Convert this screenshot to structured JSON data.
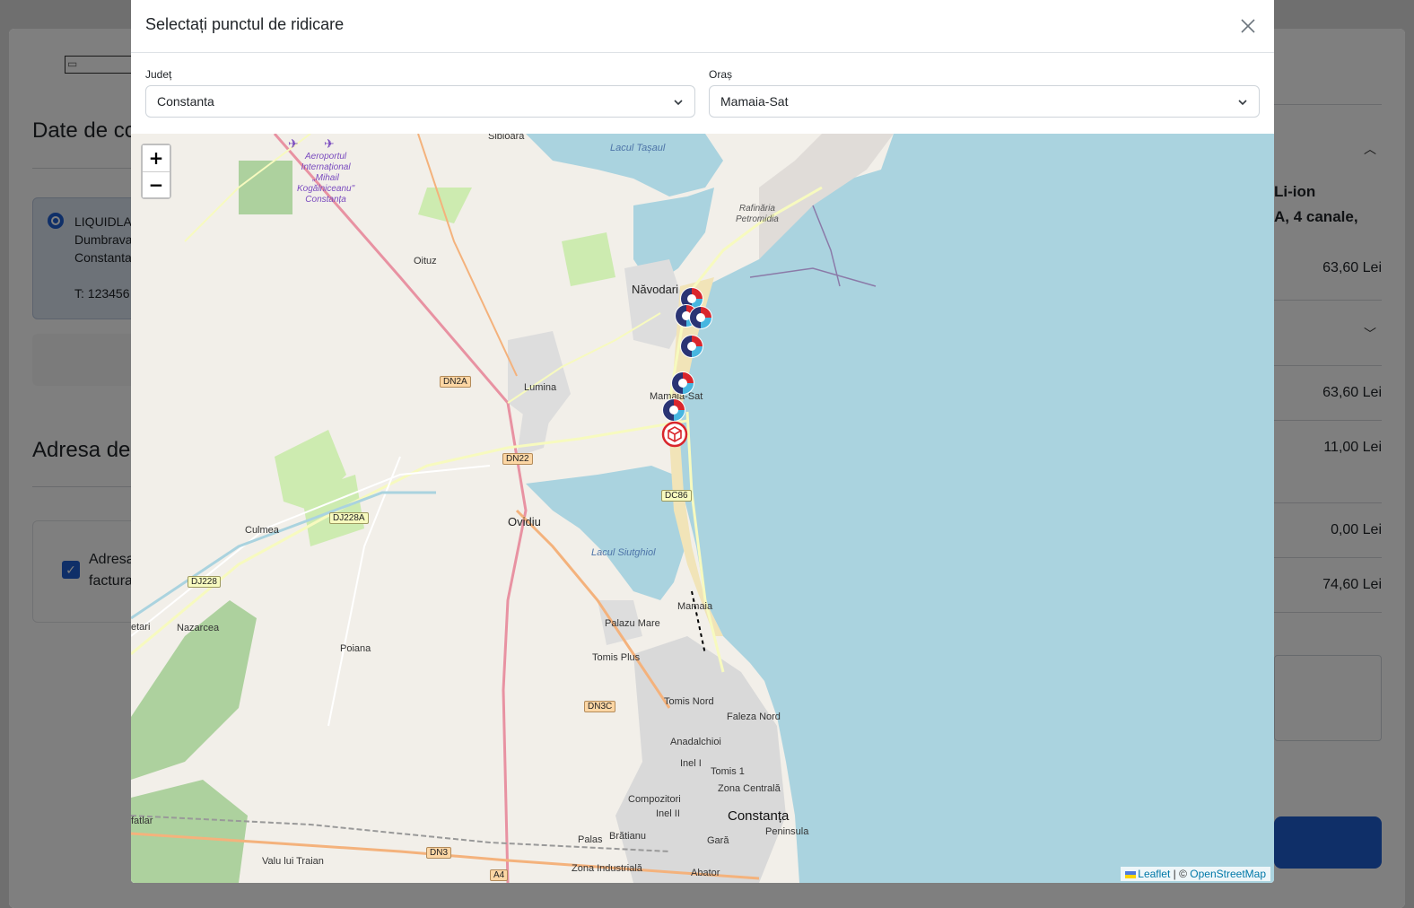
{
  "background": {
    "section1_title": "Date de co",
    "address_card": {
      "name": "LIQUIDLA",
      "line1": "Dumbrava",
      "line2": "Constanta",
      "phone": "T: 123456"
    },
    "section2_title": "Adresa de",
    "billing_label_1": "Adresa",
    "billing_label_2": "factura",
    "right_panel": {
      "product_line1": "Li-ion",
      "product_line2": "A, 4 canale,",
      "price1": "63,60 Lei",
      "price2": "63,60 Lei",
      "price3": "11,00 Lei",
      "price4": "0,00 Lei",
      "price5": "74,60 Lei"
    }
  },
  "modal": {
    "title": "Selectați punctul de ridicare",
    "county_label": "Județ",
    "county_value": "Constanta",
    "city_label": "Oraș",
    "city_value": "Mamaia-Sat"
  },
  "map": {
    "zoom_in": "+",
    "zoom_out": "−",
    "attribution_leaflet": "Leaflet",
    "attribution_sep": " | © ",
    "attribution_osm": "OpenStreetMap",
    "labels": {
      "sibioara": "Sibioara",
      "lacul_tasaul": "Lacul Tașaul",
      "airport_1": "Aeroportul",
      "airport_2": "Internațional",
      "airport_3": "„Mihail",
      "airport_4": "Kogălniceanu\"",
      "airport_5": "Constanța",
      "rafinaria_1": "Rafinăria",
      "rafinaria_2": "Petromidia",
      "oituz": "Oituz",
      "navodari": "Năvodari",
      "lumina": "Lumina",
      "mamaia_sat": "Mamaia-Sat",
      "ovidiu": "Ovidiu",
      "culmea": "Culmea",
      "lacul_siutghiol": "Lacul Siutghiol",
      "nazarcea": "Nazarcea",
      "poiana": "Poiana",
      "palazu_mare": "Palazu Mare",
      "mamaia": "Mamaia",
      "tomis_plus": "Tomis Plus",
      "tomis_nord": "Tomis Nord",
      "faleza_nord": "Faleza Nord",
      "anadalchioi": "Anadalchioi",
      "inel_i": "Inel I",
      "tomis_1": "Tomis 1",
      "zona_centrala": "Zona Centrală",
      "compozitori": "Compozitori",
      "inel_ii": "Inel II",
      "constanta": "Constanța",
      "peninsula": "Peninsula",
      "gara": "Gară",
      "palas": "Palas",
      "bratianu": "Brătianu",
      "valu_lui_traian": "Valu lui Traian",
      "zona_industriala": "Zona Industrială",
      "abator": "Abator",
      "ovidiu_left": "etari",
      "fatlar": "fatlar"
    },
    "roads": {
      "dn2a": "DN2A",
      "dn22": "DN22",
      "dj228a": "DJ228A",
      "dj228": "DJ228",
      "dc86": "DC86",
      "dn3c": "DN3C",
      "dn3": "DN3",
      "a4": "A4"
    },
    "markers": [
      {
        "kind": "easybox"
      },
      {
        "kind": "easybox"
      },
      {
        "kind": "easybox"
      },
      {
        "kind": "easybox"
      },
      {
        "kind": "easybox"
      },
      {
        "kind": "easybox"
      },
      {
        "kind": "parcel-locker"
      }
    ]
  },
  "colors": {
    "primary": "#1f5fd1",
    "water": "#aad3df",
    "land": "#f2efe9",
    "marker_red": "#d9262c",
    "marker_navy": "#2a3474",
    "marker_teal": "#47b6e0"
  }
}
